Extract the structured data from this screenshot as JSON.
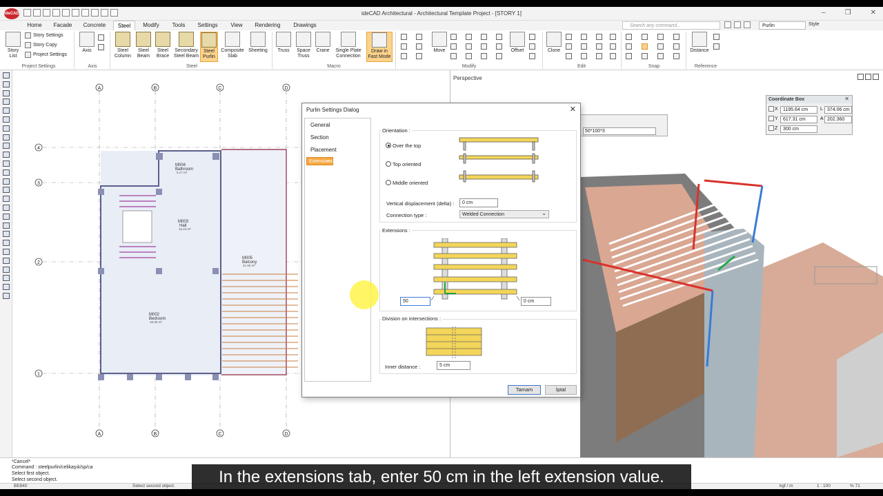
{
  "window": {
    "logo": "ideCAD",
    "title": "ideCAD Architectural - Architectural Template Project - [STORY 1]",
    "controls": [
      "–",
      "❐",
      "✕"
    ]
  },
  "tabs": [
    "Home",
    "Facade",
    "Concrete",
    "Steel",
    "Modify",
    "Tools",
    "Settings",
    "View",
    "Rendering",
    "Drawings"
  ],
  "search": {
    "placeholder": "Search any command..."
  },
  "toolbar_right": {
    "purlin_select": "Purlin",
    "style": "Style"
  },
  "ribbon": {
    "project": {
      "story_list": "Story List",
      "story_settings": "Story Settings",
      "story_copy": "Story Copy",
      "project_settings": "Project Settings",
      "group": "Project Settings"
    },
    "axis": {
      "axis": "Axis",
      "group": "Axis"
    },
    "steel": {
      "column": "Steel Column",
      "beam": "Steel Beam",
      "brace": "Steel Brace",
      "secondary": "Secondary Steel Beam",
      "purlin": "Steel Purlin",
      "composite": "Composite Slab",
      "sheeting": "Sheeting",
      "group": "Steel"
    },
    "macro": {
      "truss": "Truss",
      "space_truss": "Space Truss",
      "crane": "Crane",
      "single_plate": "Single Plate Connection",
      "draw_fast": "Draw in Fast Mode",
      "group": "Macro"
    },
    "modify": {
      "move": "Move",
      "offset": "Offset",
      "group": "Modify"
    },
    "edit": {
      "clone": "Clone",
      "group": "Edit"
    },
    "snap": {
      "group": "Snap"
    },
    "reference": {
      "distance": "Distance",
      "group": "Reference"
    }
  },
  "plan": {
    "axes_top": [
      "A",
      "B",
      "C",
      "D"
    ],
    "axes_left": [
      "4",
      "3",
      "2",
      "1"
    ],
    "rooms": [
      {
        "code": "M004",
        "name": "Bathroom",
        "area": "5.17 m²"
      },
      {
        "code": "M003",
        "name": "Hall",
        "area": "15.24 m²"
      },
      {
        "code": "M005",
        "name": "Balcony",
        "area": "21.05 m²"
      },
      {
        "code": "M002",
        "name": "Bedroom",
        "area": "16.30 m²"
      }
    ]
  },
  "perspective": {
    "label": "Perspective",
    "profile": "50*100*3"
  },
  "coordinate_box": {
    "title": "Coordinate Box",
    "x": "1195.64 cm",
    "y": "617.31 cm",
    "z": "300 cm",
    "L": "374.06 cm",
    "A": "202.360"
  },
  "dialog": {
    "title": "Purlin Settings Dialog",
    "nav": [
      "General",
      "Section",
      "Placement",
      "Extensions"
    ],
    "selected_nav": "Extensions",
    "orientation": {
      "label": "Orientation :",
      "options": [
        "Over the top",
        "Top oriented",
        "Middle oriented"
      ],
      "selected": "Over the top"
    },
    "vertical_displacement": {
      "label": "Vertical displacement (delta) :",
      "value": "0 cm"
    },
    "connection_type": {
      "label": "Connection type :",
      "value": "Welded Connection"
    },
    "extensions": {
      "label": "Extensions :",
      "left_value": "50",
      "right_value": "0 cm"
    },
    "division": {
      "label": "Division on intersections :",
      "inner_label": "Inner distance :",
      "inner_value": "5 cm"
    },
    "buttons": {
      "ok": "Tamam",
      "cancel": "İptal"
    }
  },
  "command": {
    "lines": [
      "*Cancel*",
      "Command : steelpurlin/celikaşık/sp/ca",
      "Select first object.",
      "Select second object."
    ]
  },
  "status": {
    "left": "BE840",
    "prompt": "Select second object.",
    "units": "kgf / m",
    "scale": "1 : 100",
    "zoom": "% 71"
  },
  "caption": "In the extensions tab, enter 50 cm in the left extension value."
}
